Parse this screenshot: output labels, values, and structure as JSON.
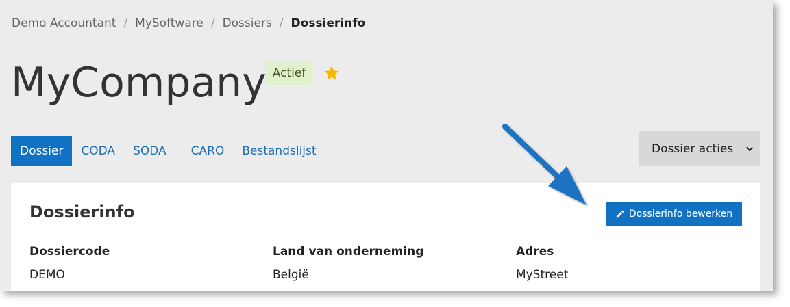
{
  "breadcrumb": {
    "items": [
      "Demo Accountant",
      "MySoftware",
      "Dossiers"
    ],
    "separator": "/",
    "current": "Dossierinfo"
  },
  "header": {
    "title": "MyCompany",
    "status_badge": "Actief",
    "favorite_icon": "star-icon"
  },
  "tabs": [
    {
      "label": "Dossier",
      "active": true
    },
    {
      "label": "CODA",
      "active": false
    },
    {
      "label": "SODA",
      "active": false
    },
    {
      "label": "CARO",
      "active": false
    },
    {
      "label": "Bestandslijst",
      "active": false
    }
  ],
  "actions_dropdown": {
    "label": "Dossier acties",
    "icon": "chevron-down-icon"
  },
  "card": {
    "title": "Dossierinfo",
    "edit_button": "Dossierinfo bewerken",
    "edit_icon": "pencil-icon",
    "fields": [
      {
        "label": "Dossiercode",
        "value": "DEMO"
      },
      {
        "label": "Land van onderneming",
        "value": "België"
      },
      {
        "label": "Adres",
        "value": "MyStreet"
      }
    ]
  },
  "colors": {
    "accent": "#1172c4",
    "badge_bg": "#e2f0d0",
    "star": "#f5b800",
    "annotation_arrow": "#1a73c2"
  }
}
